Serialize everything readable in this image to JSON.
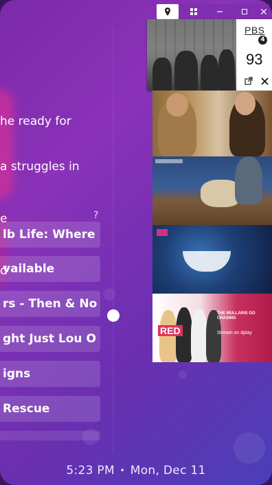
{
  "description": {
    "lines": [
      "he ready for",
      "a struggles in",
      "e",
      "d"
    ]
  },
  "help_mark": "?",
  "menu": {
    "items": [
      {
        "label": "lb Life: Where"
      },
      {
        "label": "vailable"
      },
      {
        "label": "rs - Then & No"
      },
      {
        "label": "ght Just Lou O"
      },
      {
        "label": "igns"
      },
      {
        "label": "Rescue"
      }
    ]
  },
  "status_bar": {
    "time": "5:23 PM",
    "separator": "•",
    "date": "Mon, Dec 11"
  },
  "window_toolbar": {
    "icons": [
      "map-pin-icon",
      "grid-icon",
      "minimize-icon",
      "maximize-icon",
      "close-icon"
    ]
  },
  "pip_player": {
    "network": "PBS",
    "network_badge": "4",
    "channel": "93",
    "popout_icon": "popout-icon",
    "close_icon": "close-icon"
  },
  "thumbnails": [
    {
      "name": "show-thumb-1"
    },
    {
      "name": "show-thumb-2"
    },
    {
      "name": "show-thumb-3"
    },
    {
      "name": "show-thumb-4",
      "badge": "RED",
      "title": "THE MULLARIS GO CHASING",
      "tagline": "Stream on dplay"
    }
  ],
  "colors": {
    "background_gradient_start": "#7b2aa8",
    "background_gradient_end": "#4a3fb8",
    "toolbar": "#7f2fb0"
  }
}
